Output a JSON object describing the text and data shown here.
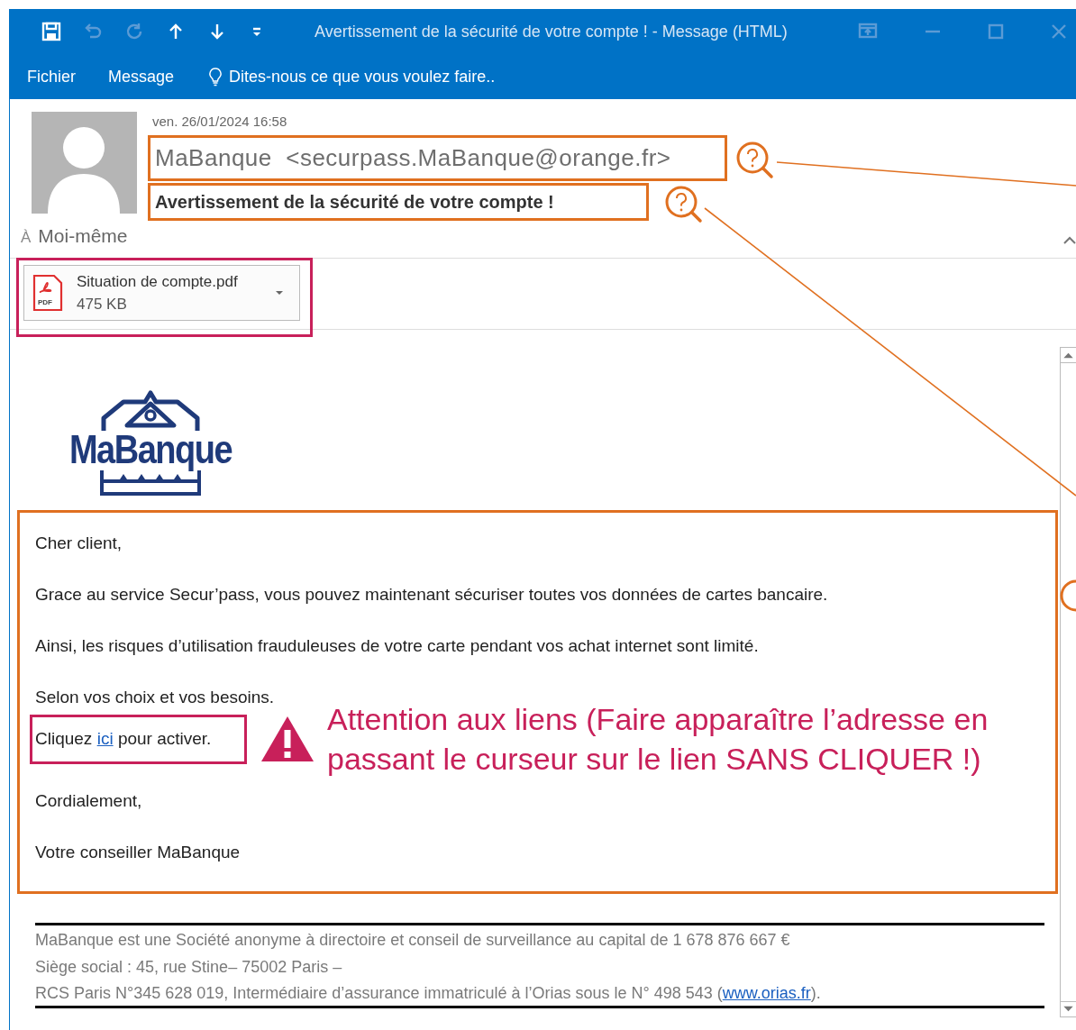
{
  "window": {
    "title": "Avertissement de la sécurité de votre compte ! - Message (HTML)"
  },
  "ribbon": {
    "tabs": [
      {
        "label": "Fichier"
      },
      {
        "label": "Message"
      }
    ],
    "tell_me": "Dites-nous ce que vous voulez faire.."
  },
  "header": {
    "date": "ven. 26/01/2024 16:58",
    "sender": "MaBanque  <securpass.MaBanque@orange.fr>",
    "subject": "Avertissement de la sécurité de votre compte !",
    "to_label": "À",
    "to": "Moi-même"
  },
  "attachment": {
    "name": "Situation de compte.pdf",
    "size": "475 KB",
    "type_label": "PDF"
  },
  "logo": {
    "text": "MaBanque"
  },
  "body": [
    {
      "kind": "text",
      "text": "Cher client,"
    },
    {
      "kind": "text",
      "text": "Grace au service Secur’pass, vous pouvez maintenant sécuriser toutes vos données de cartes bancaire."
    },
    {
      "kind": "text",
      "text": "Ainsi, les risques d’utilisation frauduleuses de votre carte pendant vos achat internet sont limité."
    },
    {
      "kind": "text",
      "text": "Selon vos choix et vos besoins."
    },
    {
      "kind": "link",
      "before": "Cliquez ",
      "link": "ici",
      "after": " pour activer.",
      "warning": "Attention aux liens (Faire apparaître l’adresse en passant  le curseur sur le lien SANS CLIQUER !)"
    },
    {
      "kind": "text",
      "text": "Cordialement,"
    },
    {
      "kind": "text",
      "text": "Votre conseiller MaBanque"
    }
  ],
  "footer": [
    {
      "kind": "text",
      "text": "MaBanque est une Société anonyme à directoire et conseil de surveillance au capital de 1 678 876 667 €"
    },
    {
      "kind": "text",
      "text": "Siège social : 45, rue Stine– 75002 Paris –"
    },
    {
      "kind": "link",
      "before": "RCS Paris N°345 628 019, Intermédiaire d’assurance immatriculé à l’Orias sous le N° 498 543 (",
      "link": "www.orias.fr",
      "after": ")."
    }
  ]
}
